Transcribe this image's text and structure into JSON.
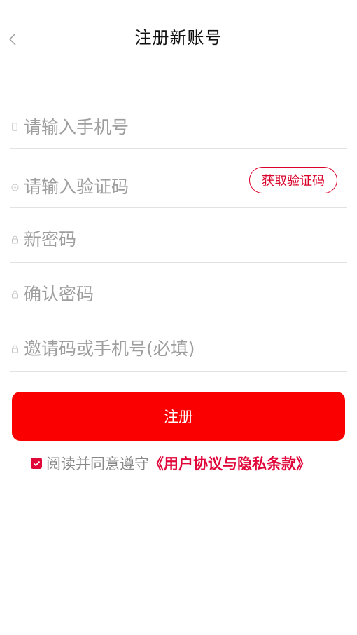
{
  "header": {
    "title": "注册新账号",
    "back_icon": "chevron-left-icon"
  },
  "form": {
    "phone": {
      "placeholder": "请输入手机号",
      "value": "",
      "icon": "phone-icon"
    },
    "code": {
      "placeholder": "请输入验证码",
      "value": "",
      "icon": "shield-icon",
      "get_code_label": "获取验证码"
    },
    "password": {
      "placeholder": "新密码",
      "value": "",
      "icon": "lock-icon"
    },
    "confirm_password": {
      "placeholder": "确认密码",
      "value": "",
      "icon": "lock-icon"
    },
    "invite": {
      "placeholder": "邀请码或手机号(必填)",
      "value": "",
      "icon": "lock-icon"
    }
  },
  "register_button": {
    "label": "注册"
  },
  "agreement": {
    "checked": true,
    "text": "阅读并同意遵守",
    "link_text": "《用户协议与隐私条款》"
  },
  "colors": {
    "accent": "#fb0000",
    "link": "#e0063a",
    "placeholder": "#9e9e9e"
  }
}
